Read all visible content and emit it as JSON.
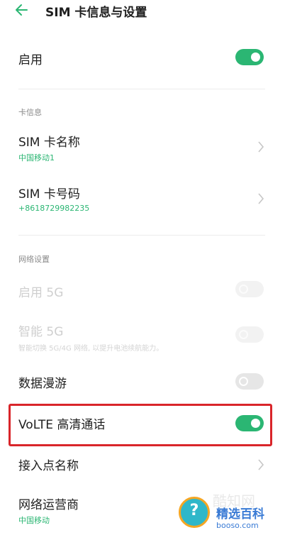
{
  "header": {
    "title": "SIM 卡信息与设置"
  },
  "enable_row": {
    "label": "启用",
    "toggle": "on"
  },
  "card_info": {
    "section_title": "卡信息",
    "name_row": {
      "label": "SIM 卡名称",
      "value": "中国移动1"
    },
    "number_row": {
      "label": "SIM 卡号码",
      "value": "+8618729982235"
    }
  },
  "network": {
    "section_title": "网络设置",
    "enable_5g": {
      "label": "启用 5G",
      "toggle": "off",
      "state": "disabled"
    },
    "smart_5g": {
      "label": "智能 5G",
      "description": "智能切换 5G/4G 网络, 以提升电池续航能力。",
      "toggle": "off",
      "state": "disabled"
    },
    "data_roaming": {
      "label": "数据漫游",
      "toggle": "off"
    },
    "volte": {
      "label": "VoLTE 高清通话",
      "toggle": "on"
    },
    "apn": {
      "label": "接入点名称"
    },
    "operator": {
      "label": "网络运营商",
      "value": "中国移动"
    }
  },
  "watermark": {
    "icon_glyph": "?",
    "brand": "精选百科",
    "domain": "booso.com",
    "ghost_text": "酷知网"
  },
  "colors": {
    "accent": "#2bb673",
    "highlight_border": "#d9252a",
    "toggle_off": "#e6e6e6"
  }
}
